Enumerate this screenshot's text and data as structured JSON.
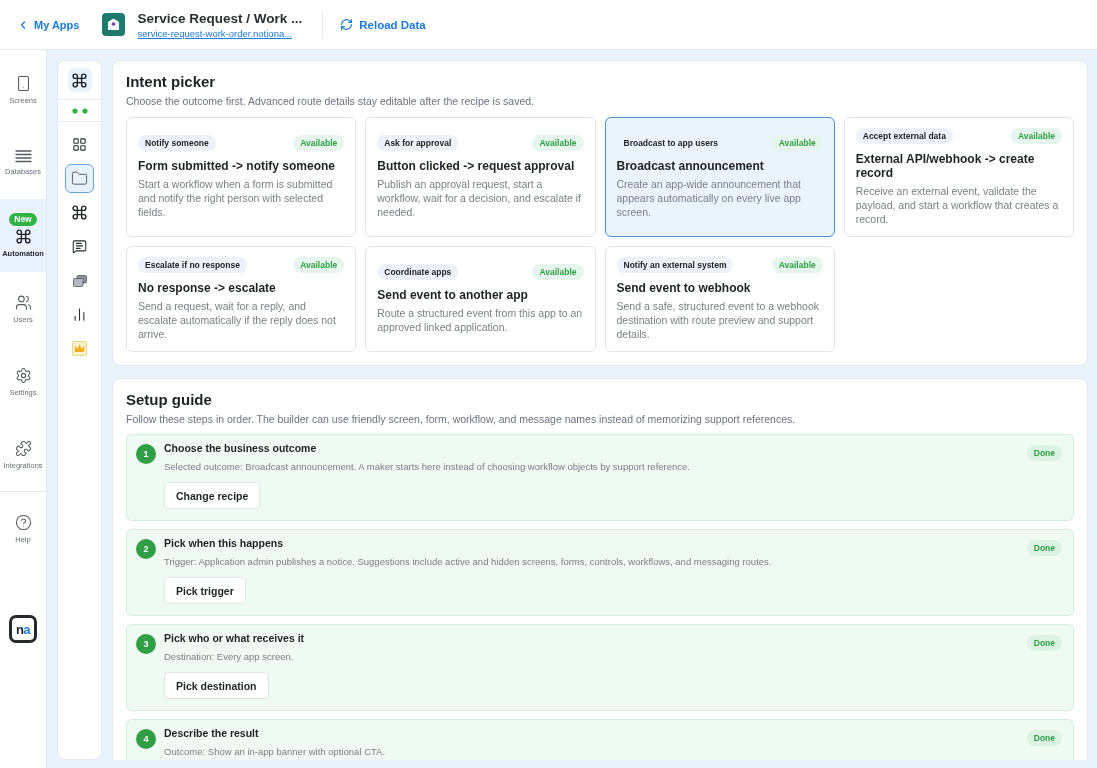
{
  "top_bar": {
    "back_link": "My Apps",
    "app": {
      "title": "Service Request / Work ...",
      "url": "service-request-work-order.notiona..."
    },
    "reload_button": "Reload Data"
  },
  "nav": {
    "items": [
      {
        "kind": "screens",
        "label": "Screens",
        "selected": false
      },
      {
        "kind": "databases",
        "label": "Databases",
        "selected": false
      },
      {
        "kind": "automation",
        "label": "Automation",
        "badge": "New",
        "selected": true
      },
      {
        "kind": "users",
        "label": "Users",
        "selected": false
      },
      {
        "kind": "settings",
        "label": "Settings",
        "selected": false
      },
      {
        "kind": "integrations",
        "label": "Integrations",
        "selected": false
      }
    ],
    "footer_items": [
      {
        "kind": "help",
        "label": "Help",
        "selected": false
      }
    ],
    "logo": {
      "parts": [
        "n",
        "a"
      ]
    }
  },
  "tool_rail": {
    "header": {
      "kind": "command",
      "selected": true
    },
    "items": [
      {
        "kind": "grid",
        "selected": false
      },
      {
        "kind": "folder",
        "selected": true
      },
      {
        "kind": "command",
        "selected": false
      },
      {
        "kind": "chat",
        "selected": false
      },
      {
        "kind": "windows",
        "selected": false
      },
      {
        "kind": "chart",
        "selected": false
      },
      {
        "kind": "crown",
        "selected": false
      }
    ]
  },
  "intent_picker": {
    "title": "Intent picker",
    "subtitle": "Choose the outcome first. Advanced route details stay editable after the recipe is saved.",
    "cards": [
      {
        "tag": "Notify someone",
        "status": "Available",
        "title": "Form submitted -> notify someone",
        "description": "Start a workflow when a form is submitted and notify the right person with selected fields.",
        "selected": false
      },
      {
        "tag": "Ask for approval",
        "status": "Available",
        "title": "Button clicked -> request approval",
        "description": "Publish an approval request, start a workflow, wait for a decision, and escalate if needed.",
        "selected": false
      },
      {
        "tag": "Broadcast to app users",
        "status": "Available",
        "title": "Broadcast announcement",
        "description": "Create an app-wide announcement that appears automatically on every live app screen.",
        "selected": true
      },
      {
        "tag": "Accept external data",
        "status": "Available",
        "title": "External API/webhook -> create record",
        "description": "Receive an external event, validate the payload, and start a workflow that creates a record.",
        "selected": false
      },
      {
        "tag": "Escalate if no response",
        "status": "Available",
        "title": "No response -> escalate",
        "description": "Send a request, wait for a reply, and escalate automatically if the reply does not arrive.",
        "selected": false
      },
      {
        "tag": "Coordinate apps",
        "status": "Available",
        "title": "Send event to another app",
        "description": "Route a structured event from this app to an approved linked application.",
        "selected": false
      },
      {
        "tag": "Notify an external system",
        "status": "Available",
        "title": "Send event to webhook",
        "description": "Send a safe, structured event to a webhook destination with route preview and support details.",
        "selected": false
      }
    ]
  },
  "setup_guide": {
    "title": "Setup guide",
    "subtitle": "Follow these steps in order. The builder can use friendly screen, form, workflow, and message names instead of memorizing support references.",
    "steps": [
      {
        "number": "1",
        "title": "Choose the business outcome",
        "description": "Selected outcome: Broadcast announcement. A maker starts here instead of choosing workflow objects by support reference.",
        "button": "Change recipe",
        "status": "Done"
      },
      {
        "number": "2",
        "title": "Pick when this happens",
        "description": "Trigger: Application admin publishes a notice. Suggestions include active and hidden screens, forms, controls, workflows, and messaging routes.",
        "button": "Pick trigger",
        "status": "Done"
      },
      {
        "number": "3",
        "title": "Pick who or what receives it",
        "description": "Destination: Every app screen.",
        "button": "Pick destination",
        "status": "Done"
      },
      {
        "number": "4",
        "title": "Describe the result",
        "description": "Outcome: Show an in-app banner with optional CTA.",
        "status": "Done"
      }
    ]
  }
}
